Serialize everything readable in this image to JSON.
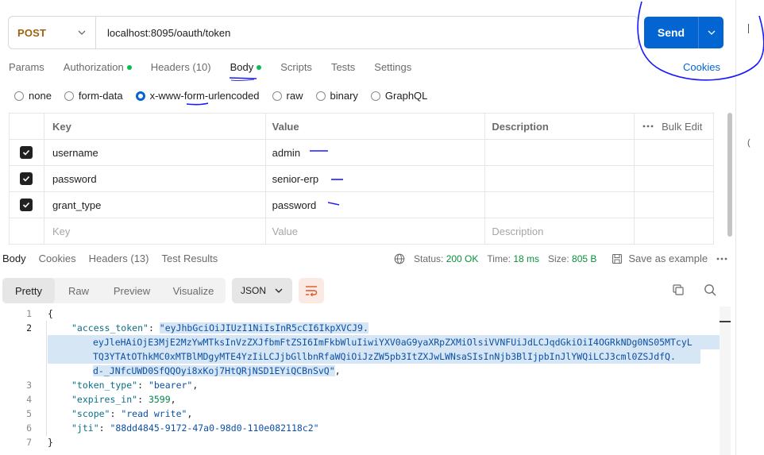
{
  "request": {
    "method": "POST",
    "url": "localhost:8095/oauth/token",
    "send_label": "Send",
    "cookies_label": "Cookies"
  },
  "request_tabs": [
    {
      "label": "Params",
      "dot": false
    },
    {
      "label": "Authorization",
      "dot": true
    },
    {
      "label": "Headers (10)",
      "dot": false
    },
    {
      "label": "Body",
      "dot": true,
      "active": true
    },
    {
      "label": "Scripts",
      "dot": false
    },
    {
      "label": "Tests",
      "dot": false
    },
    {
      "label": "Settings",
      "dot": false
    }
  ],
  "body_types": [
    {
      "label": "none",
      "selected": false
    },
    {
      "label": "form-data",
      "selected": false
    },
    {
      "label": "x-www-form-urlencoded",
      "selected": true
    },
    {
      "label": "raw",
      "selected": false
    },
    {
      "label": "binary",
      "selected": false
    },
    {
      "label": "GraphQL",
      "selected": false
    }
  ],
  "params_table": {
    "headers": {
      "key": "Key",
      "value": "Value",
      "description": "Description",
      "bulk_edit": "Bulk Edit"
    },
    "rows": [
      {
        "checked": true,
        "key": "username",
        "value": "admin",
        "description": ""
      },
      {
        "checked": true,
        "key": "password",
        "value": "senior-erp",
        "description": ""
      },
      {
        "checked": true,
        "key": "grant_type",
        "value": "password",
        "description": ""
      }
    ],
    "placeholder": {
      "key": "Key",
      "value": "Value",
      "description": "Description"
    }
  },
  "response": {
    "tabs": [
      {
        "label": "Body",
        "active": true
      },
      {
        "label": "Cookies"
      },
      {
        "label": "Headers (13)"
      },
      {
        "label": "Test Results"
      }
    ],
    "status_label": "Status:",
    "status_value": "200 OK",
    "time_label": "Time:",
    "time_value": "18 ms",
    "size_label": "Size:",
    "size_value": "805 B",
    "save_label": "Save as example",
    "view_modes": [
      "Pretty",
      "Raw",
      "Preview",
      "Visualize"
    ],
    "format": "JSON",
    "code_lines": [
      {
        "n": "1",
        "text": "{"
      },
      {
        "n": "2",
        "key": "\"access_token\"",
        "value": "\"eyJhbGciOiJIUzI1NiIsInR5cCI6IkpXVCJ9.",
        "cont": [
          "eyJleHAiOjE3MjE2MzYwMTksInVzZXJfbmFtZSI6ImFkbWluIiwiYXV0aG9yaXRpZXMiOlsiVVNFUiJdLCJqdGkiOiI4OGRkNDg0NS05MTcyL",
          "TQ3YTAtOThkMC0xMTBlMDgyMTE4YzIiLCJjbGllbnRfaWQiOiJzZW5pb3ItZXJwLWNsaSIsInNjb3BlIjpbInJlYWQiLCJ3cml0ZSJdfQ.",
          "d-_JNfcUWD0SfQQOyi8xKoj7HtQRjNSD1EYiQCBnSvQ\""
        ]
      },
      {
        "n": "3",
        "key": "\"token_type\"",
        "value": "\"bearer\""
      },
      {
        "n": "4",
        "key": "\"expires_in\"",
        "value": "3599"
      },
      {
        "n": "5",
        "key": "\"scope\"",
        "value": "\"read write\""
      },
      {
        "n": "6",
        "key": "\"jti\"",
        "value": "\"88dd4845-9172-47a0-98d0-110e082118c2\""
      },
      {
        "n": "7",
        "text": "}"
      }
    ]
  },
  "colors": {
    "accent": "#0265d2",
    "method": "#a1620d",
    "success": "#0a8f3c",
    "dot": "#0cbb52",
    "annotation_ink": "#1a1aff"
  }
}
